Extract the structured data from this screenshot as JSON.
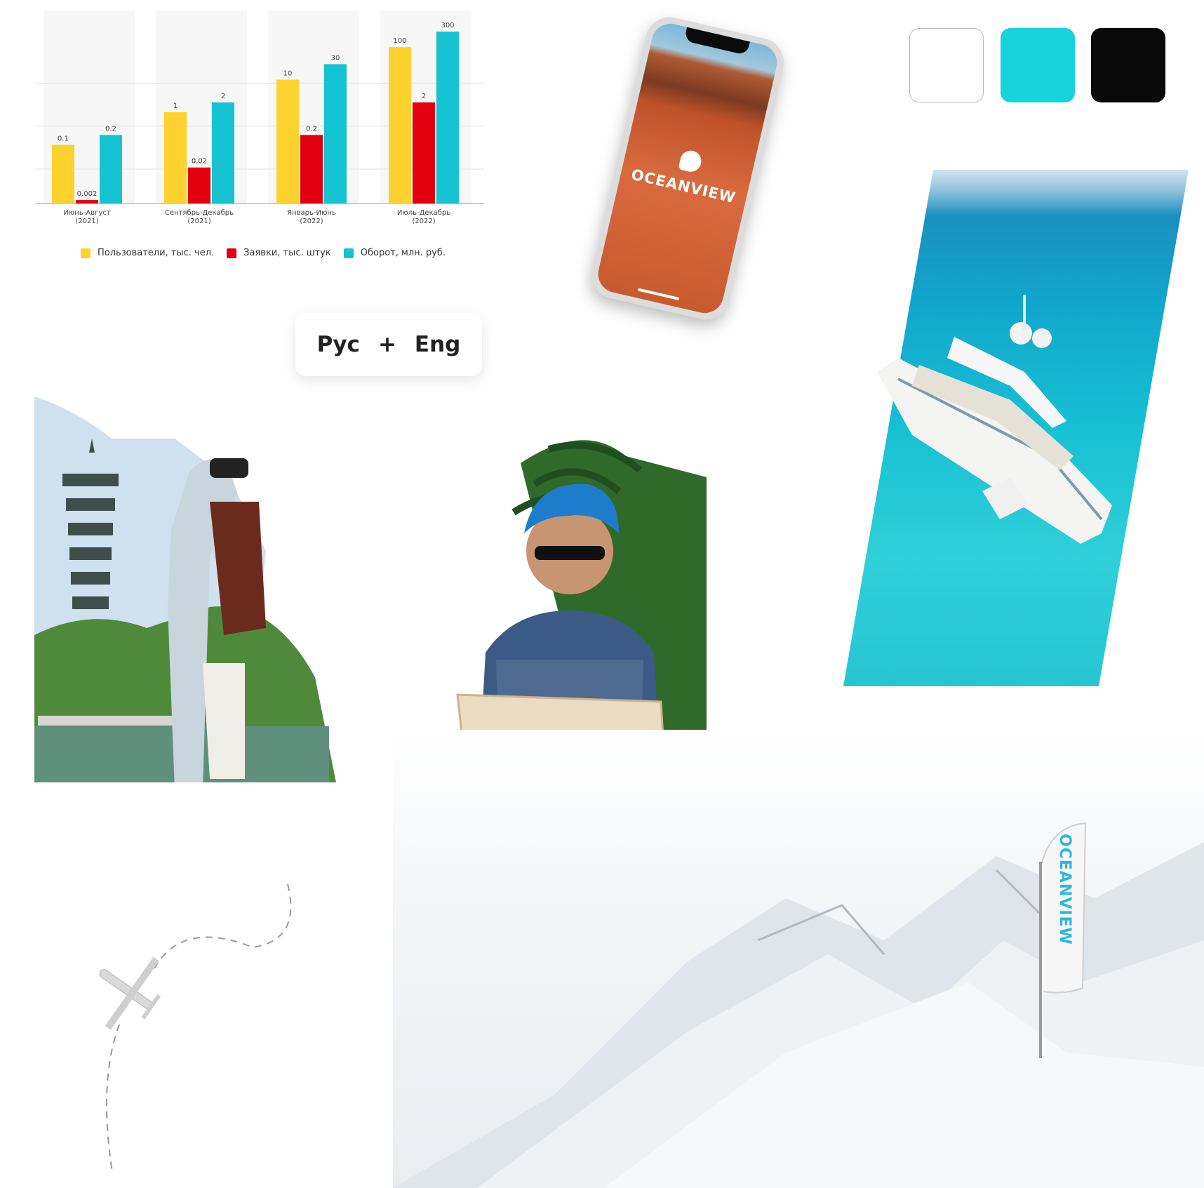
{
  "chart_data": {
    "type": "bar",
    "categories": [
      {
        "label": "Июнь-Август",
        "year": "(2021)"
      },
      {
        "label": "Сентябрь-Декабрь",
        "year": "(2021)"
      },
      {
        "label": "Январь-Июнь",
        "year": "(2022)"
      },
      {
        "label": "Июль-Декабрь",
        "year": "(2022)"
      }
    ],
    "series": [
      {
        "name": "Пользователи, тыс. чел.",
        "color": "#fdd12e",
        "values": [
          0.1,
          1,
          10,
          100
        ],
        "labels": [
          "0.1",
          "1",
          "10",
          "100"
        ]
      },
      {
        "name": "Заявки, тыс. штук",
        "color": "#e3000f",
        "values": [
          0.002,
          0.02,
          0.2,
          2
        ],
        "labels": [
          "0.002",
          "0.02",
          "0.2",
          "2"
        ]
      },
      {
        "name": "Оборот, млн. руб.",
        "color": "#16c3d3",
        "values": [
          0.2,
          2,
          30,
          300
        ],
        "labels": [
          "0.2",
          "2",
          "30",
          "300"
        ]
      }
    ],
    "yscale": "log",
    "grid": true,
    "legend_position": "bottom"
  },
  "language_pill": {
    "left": "Рус",
    "sep": "+",
    "right": "Eng"
  },
  "brand": {
    "name": "OCEANVIEW",
    "colors": [
      "#ffffff",
      "#16d3dc",
      "#0a0a0a"
    ]
  },
  "icons": {
    "plane": "airplane-icon",
    "flag": "flag-banner"
  }
}
